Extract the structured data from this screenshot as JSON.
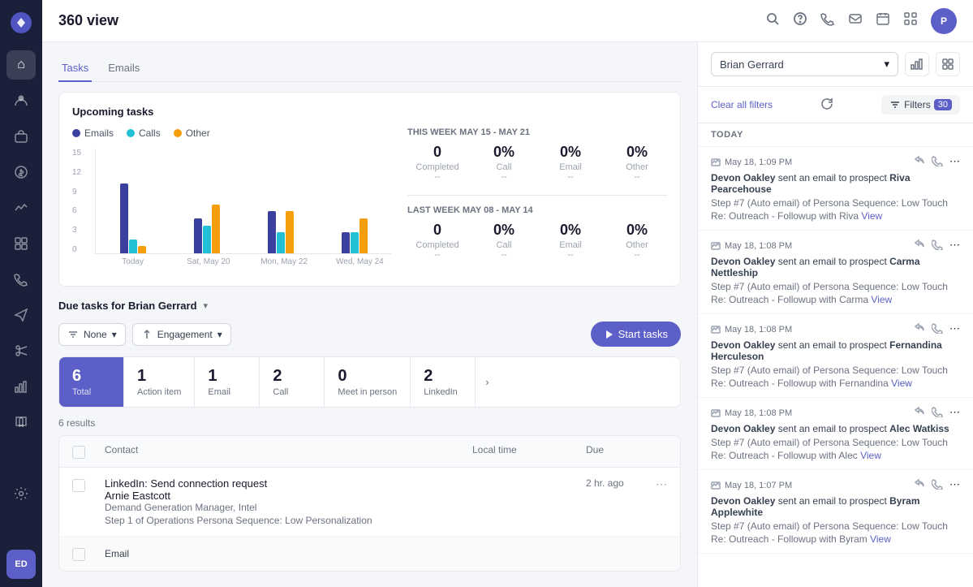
{
  "app": {
    "title": "360 view"
  },
  "sidebar": {
    "items": [
      {
        "id": "logo",
        "icon": "⬡",
        "active": false
      },
      {
        "id": "home",
        "icon": "⌂",
        "active": true
      },
      {
        "id": "users",
        "icon": "👤",
        "active": false
      },
      {
        "id": "briefcase",
        "icon": "💼",
        "active": false
      },
      {
        "id": "dollar",
        "icon": "$",
        "active": false
      },
      {
        "id": "activity",
        "icon": "📊",
        "active": false
      },
      {
        "id": "grid",
        "icon": "⊞",
        "active": false
      },
      {
        "id": "phone",
        "icon": "📞",
        "active": false
      },
      {
        "id": "send",
        "icon": "✉",
        "active": false
      },
      {
        "id": "scissors",
        "icon": "✂",
        "active": false
      },
      {
        "id": "chart",
        "icon": "📈",
        "active": false
      },
      {
        "id": "book",
        "icon": "📖",
        "active": false
      },
      {
        "id": "settings",
        "icon": "⚙",
        "active": false
      },
      {
        "id": "avatar",
        "label": "ED",
        "active": false
      }
    ]
  },
  "header": {
    "search_icon": "search",
    "help_icon": "help",
    "phone_icon": "phone",
    "email_icon": "email",
    "calendar_icon": "calendar",
    "grid_icon": "grid",
    "avatar_label": "P",
    "avatar_bg": "#5b5fc7"
  },
  "tabs": {
    "items": [
      {
        "id": "tasks",
        "label": "Tasks",
        "active": true
      },
      {
        "id": "emails",
        "label": "Emails",
        "active": false
      }
    ]
  },
  "upcoming_tasks": {
    "title": "Upcoming tasks",
    "legend": [
      {
        "label": "Emails",
        "color": "#3b3f9e"
      },
      {
        "label": "Calls",
        "color": "#22c0d5"
      },
      {
        "label": "Other",
        "color": "#f59e0b"
      }
    ],
    "chart": {
      "y_labels": [
        "15",
        "12",
        "9",
        "6",
        "3",
        "0"
      ],
      "x_labels": [
        "Today",
        "Sat, May 20",
        "Mon, May 22",
        "Wed, May 24"
      ],
      "bars": [
        {
          "email": 10,
          "call": 2,
          "other": 1
        },
        {
          "email": 5,
          "call": 4,
          "other": 7
        },
        {
          "email": 6,
          "call": 3,
          "other": 6
        },
        {
          "email": 3,
          "call": 3,
          "other": 5
        }
      ]
    },
    "this_week": {
      "label": "THIS WEEK MAY 15 - MAY 21",
      "completed": 0,
      "call_pct": "0%",
      "email_pct": "0%",
      "other_pct": "0%",
      "completed_label": "Completed",
      "call_label": "Call",
      "email_label": "Email",
      "other_label": "Other"
    },
    "last_week": {
      "label": "LAST WEEK MAY 08 - MAY 14",
      "completed": 0,
      "call_pct": "0%",
      "email_pct": "0%",
      "other_pct": "0%",
      "completed_label": "Completed",
      "call_label": "Call",
      "email_label": "Email",
      "other_label": "Other"
    }
  },
  "due_tasks": {
    "title": "Due tasks for Brian Gerrard",
    "filter_none": "None",
    "filter_engagement": "Engagement",
    "start_tasks_label": "Start tasks",
    "summary": [
      {
        "count": "6",
        "label": "Total",
        "active": true
      },
      {
        "count": "1",
        "label": "Action item",
        "active": false
      },
      {
        "count": "1",
        "label": "Email",
        "active": false
      },
      {
        "count": "2",
        "label": "Call",
        "active": false
      },
      {
        "count": "0",
        "label": "Meet in person",
        "active": false
      },
      {
        "count": "2",
        "label": "LinkedIn",
        "active": false
      }
    ],
    "results_count": "6 results",
    "table": {
      "headers": [
        "",
        "Contact",
        "Local time",
        "Due"
      ],
      "rows": [
        {
          "task_name": "LinkedIn: Send connection request",
          "contact_name": "Arnie Eastcott",
          "contact_title": "Demand Generation Manager, Intel",
          "contact_seq": "Step 1 of Operations Persona Sequence: Low Personalization",
          "local_time": "",
          "due": "2 hr. ago"
        },
        {
          "task_name": "Email",
          "contact_name": "",
          "contact_title": "",
          "contact_seq": "",
          "local_time": "",
          "due": ""
        }
      ]
    }
  },
  "right_panel": {
    "contact_name": "Brian Gerrard",
    "clear_filters": "Clear all filters",
    "filters_label": "Filters",
    "filters_count": "30",
    "today_label": "TODAY",
    "activities": [
      {
        "time": "May 18, 1:09 PM",
        "actor": "Devon Oakley",
        "action": "sent an email to prospect",
        "prospect": "Riva Pearcehouse",
        "step": "Step #7 (Auto email) of Persona Sequence: Low Touch",
        "subject": "Re: Outreach - Followup with Riva",
        "view_label": "View"
      },
      {
        "time": "May 18, 1:08 PM",
        "actor": "Devon Oakley",
        "action": "sent an email to prospect",
        "prospect": "Carma Nettleship",
        "step": "Step #7 (Auto email) of Persona Sequence: Low Touch",
        "subject": "Re: Outreach - Followup with Carma",
        "view_label": "View"
      },
      {
        "time": "May 18, 1:08 PM",
        "actor": "Devon Oakley",
        "action": "sent an email to prospect",
        "prospect": "Fernandina Herculeson",
        "step": "Step #7 (Auto email) of Persona Sequence: Low Touch",
        "subject": "Re: Outreach - Followup with Fernandina",
        "view_label": "View"
      },
      {
        "time": "May 18, 1:08 PM",
        "actor": "Devon Oakley",
        "action": "sent an email to prospect",
        "prospect": "Alec Watkiss",
        "step": "Step #7 (Auto email) of Persona Sequence: Low Touch",
        "subject": "Re: Outreach - Followup with Alec",
        "view_label": "View"
      },
      {
        "time": "May 18, 1:07 PM",
        "actor": "Devon Oakley",
        "action": "sent an email to prospect",
        "prospect": "Byram Applewhite",
        "step": "Step #7 (Auto email) of Persona Sequence: Low Touch",
        "subject": "Re: Outreach - Followup with Byram",
        "view_label": "View"
      }
    ]
  }
}
